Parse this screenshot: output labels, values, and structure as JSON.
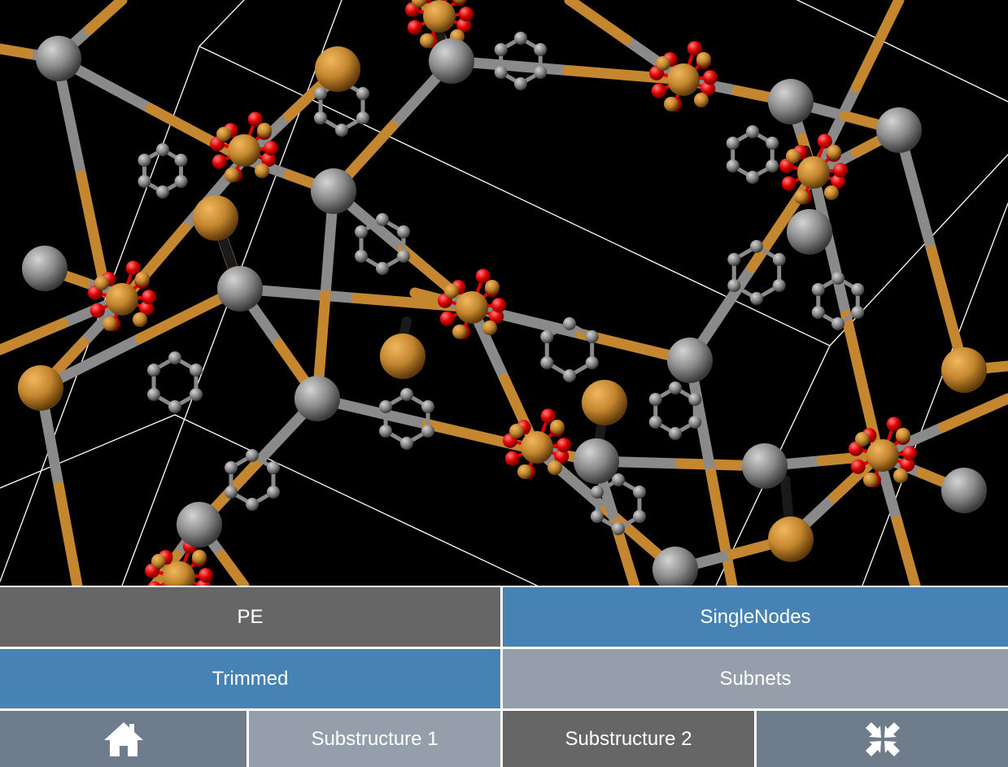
{
  "viewer": {
    "background": "#000000",
    "colors": {
      "metal_atom": "#c4862e",
      "carbon_atom": "#8a8a8a",
      "oxygen_atom": "#e00000",
      "cell_edge": "#ffffff",
      "dark_bond": "#1a1a1a"
    }
  },
  "buttons": {
    "pe": {
      "label": "PE",
      "color": "#666666"
    },
    "singlenodes": {
      "label": "SingleNodes",
      "color": "#4682b4"
    },
    "trimmed": {
      "label": "Trimmed",
      "color": "#4682b4"
    },
    "subnets": {
      "label": "Subnets",
      "color": "#949fab"
    },
    "home": {
      "icon": "home-icon",
      "color": "#6e7c8c"
    },
    "substructure1": {
      "label": "Substructure 1",
      "color": "#949fab"
    },
    "substructure2": {
      "label": "Substructure 2",
      "color": "#666666"
    },
    "collapse": {
      "icon": "collapse-icon",
      "color": "#6e7c8c"
    }
  }
}
